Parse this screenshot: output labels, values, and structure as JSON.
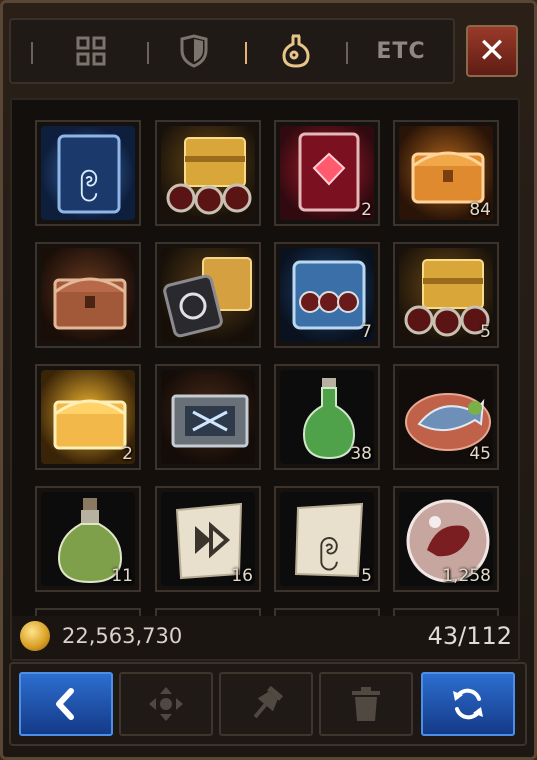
{
  "tabs": {
    "items": [
      {
        "name": "grid-tab",
        "icon": "grid-icon"
      },
      {
        "name": "equipment-tab",
        "icon": "shield-icon"
      },
      {
        "name": "consumables-tab",
        "icon": "potion-icon",
        "active": true
      },
      {
        "name": "etc-tab",
        "label": "ETC"
      }
    ]
  },
  "close_icon": "close-icon",
  "items": [
    {
      "name": "card-pack-blue",
      "qty": ""
    },
    {
      "name": "golden-chest-with-orbs",
      "qty": ""
    },
    {
      "name": "red-gem-card",
      "qty": "2"
    },
    {
      "name": "orange-glowing-chest",
      "qty": "84"
    },
    {
      "name": "ornate-copper-chest",
      "qty": ""
    },
    {
      "name": "chest-with-rune-card",
      "qty": ""
    },
    {
      "name": "blue-display-chest",
      "qty": "7"
    },
    {
      "name": "golden-chest-with-orbs-2",
      "qty": "5"
    },
    {
      "name": "golden-glowing-chest",
      "qty": "2"
    },
    {
      "name": "silver-rune-crate",
      "qty": ""
    },
    {
      "name": "green-potion-flask",
      "qty": "38"
    },
    {
      "name": "fish-dish",
      "qty": "45"
    },
    {
      "name": "green-tonic-bottle",
      "qty": "11"
    },
    {
      "name": "scroll-arrow",
      "qty": "16"
    },
    {
      "name": "scroll-rune",
      "qty": "5"
    },
    {
      "name": "dragon-orb",
      "qty": "1,258"
    }
  ],
  "footer": {
    "gold": "22,563,730",
    "capacity": "43/112"
  },
  "actions": [
    {
      "name": "back-button",
      "icon": "chevron-left-icon"
    },
    {
      "name": "move-button",
      "icon": "move-icon"
    },
    {
      "name": "pin-button",
      "icon": "pin-icon"
    },
    {
      "name": "delete-button",
      "icon": "trash-icon"
    },
    {
      "name": "sort-button",
      "icon": "refresh-icon"
    }
  ],
  "colors": {
    "accent": "#e6b273",
    "blue_button": "#2d6ed0",
    "close_button": "#9a3a2a"
  }
}
